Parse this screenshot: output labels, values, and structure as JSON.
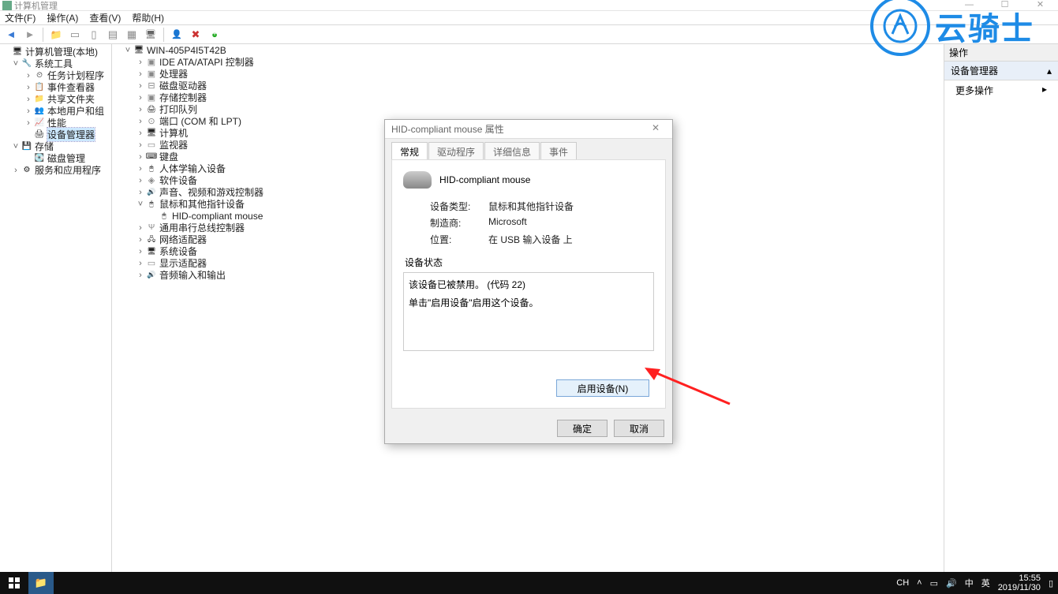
{
  "window": {
    "title": "计算机管理",
    "controls": {
      "min": "—",
      "max": "☐",
      "close": "✕"
    }
  },
  "menu": {
    "file": "文件(F)",
    "action": "操作(A)",
    "view": "查看(V)",
    "help": "帮助(H)"
  },
  "left_tree": {
    "root": "计算机管理(本地)",
    "system_tools": "系统工具",
    "task_scheduler": "任务计划程序",
    "event_viewer": "事件查看器",
    "shared_folders": "共享文件夹",
    "local_users": "本地用户和组",
    "performance": "性能",
    "device_mgr": "设备管理器",
    "storage": "存储",
    "disk_mgmt": "磁盘管理",
    "services_apps": "服务和应用程序"
  },
  "device_tree": {
    "computer": "WIN-405P4I5T42B",
    "ide": "IDE ATA/ATAPI 控制器",
    "cpu": "处理器",
    "diskdrv": "磁盘驱动器",
    "storage_ctl": "存储控制器",
    "printq": "打印队列",
    "ports": "端口 (COM 和 LPT)",
    "computers": "计算机",
    "monitors": "监视器",
    "keyboard": "键盘",
    "hid": "人体学输入设备",
    "software": "软件设备",
    "sound": "声音、视频和游戏控制器",
    "mouse": "鼠标和其他指针设备",
    "mouse_child": "HID-compliant mouse",
    "usb": "通用串行总线控制器",
    "network": "网络适配器",
    "sysdev": "系统设备",
    "display": "显示适配器",
    "audio_io": "音频输入和输出"
  },
  "actions": {
    "header": "操作",
    "item": "设备管理器",
    "more": "更多操作"
  },
  "dialog": {
    "title": "HID-compliant mouse 属性",
    "tabs": {
      "general": "常规",
      "driver": "驱动程序",
      "details": "详细信息",
      "events": "事件"
    },
    "device_name": "HID-compliant mouse",
    "type_label": "设备类型:",
    "type_value": "鼠标和其他指针设备",
    "vendor_label": "制造商:",
    "vendor_value": "Microsoft",
    "location_label": "位置:",
    "location_value": "在 USB 输入设备 上",
    "status_label": "设备状态",
    "status_line1": "该设备已被禁用。 (代码 22)",
    "status_line2": "单击\"启用设备\"启用这个设备。",
    "enable_btn": "启用设备(N)",
    "ok": "确定",
    "cancel": "取消"
  },
  "watermark": "云骑士",
  "taskbar": {
    "ime_label": "CH",
    "ime_lang": "中",
    "ime_sym": "英",
    "time": "15:55",
    "date": "2019/11/30"
  }
}
